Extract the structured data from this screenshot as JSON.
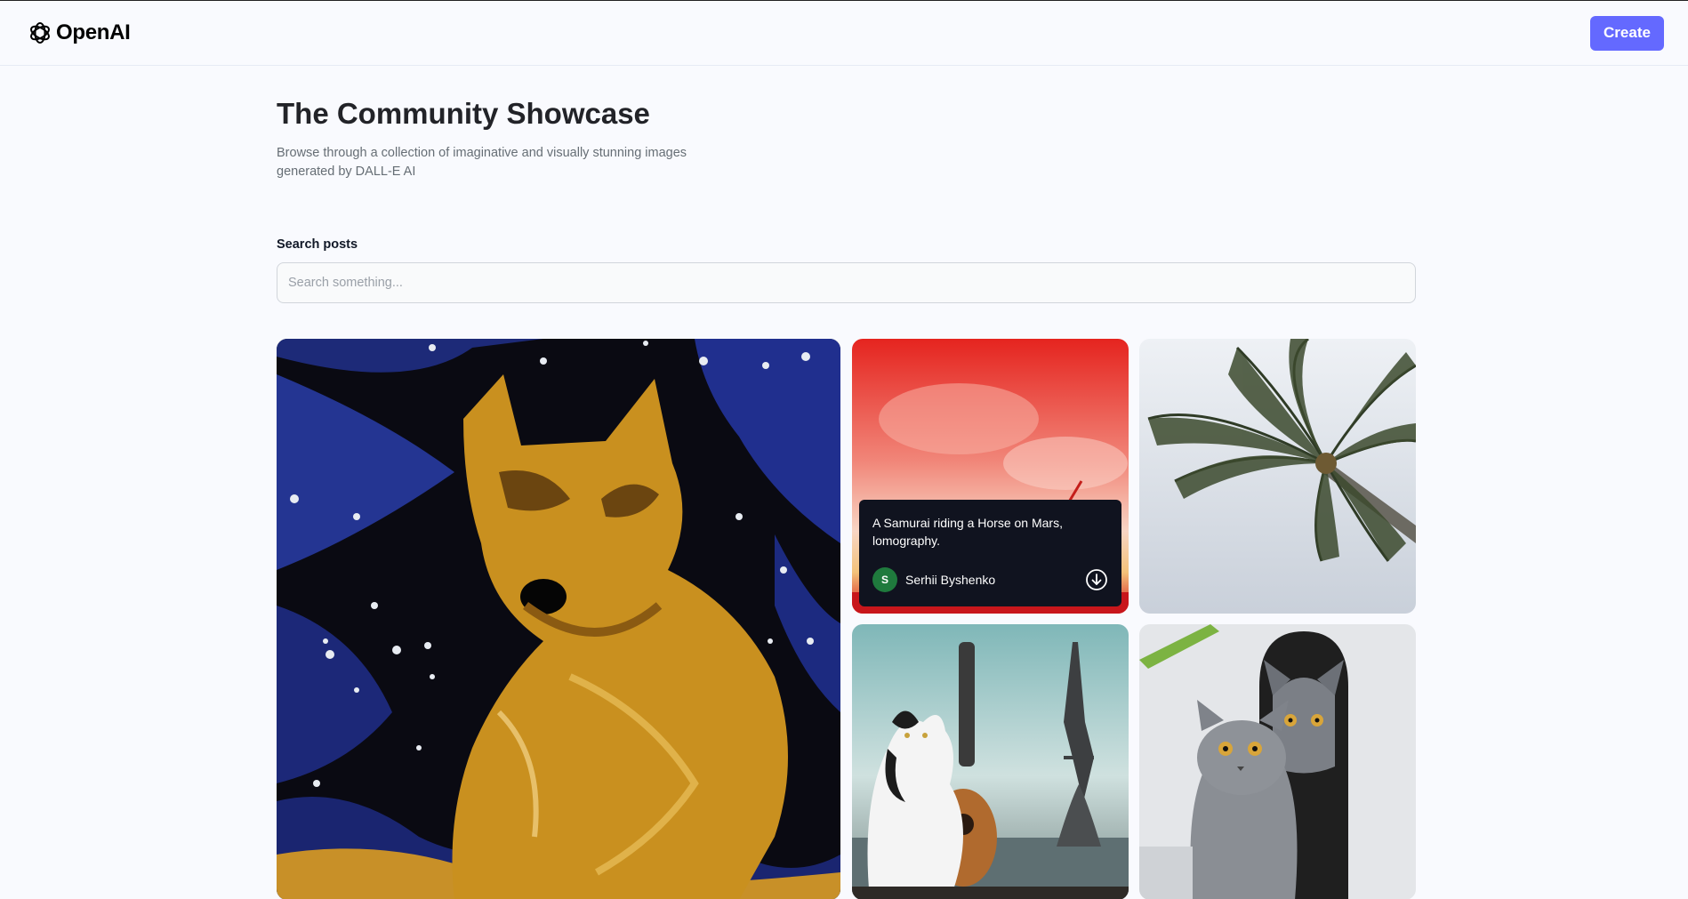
{
  "header": {
    "logo_text": "OpenAI",
    "create_label": "Create"
  },
  "hero": {
    "title": "The Community Showcase",
    "subtitle": "Browse through a collection of imaginative and visually stunning images generated by DALL-E AI"
  },
  "search": {
    "label": "Search posts",
    "value": "",
    "placeholder": "Search something..."
  },
  "gallery": {
    "hovered_card": {
      "prompt": "A Samurai riding a Horse on Mars, lomography.",
      "author_initial": "S",
      "author_name": "Serhii Byshenko"
    }
  },
  "colors": {
    "brand": "#6469ff",
    "overlay": "#10131f",
    "avatar": "#1f7a3d",
    "page_bg": "#f9fafe"
  },
  "icons": [
    "openai-logo-icon",
    "download-icon"
  ]
}
